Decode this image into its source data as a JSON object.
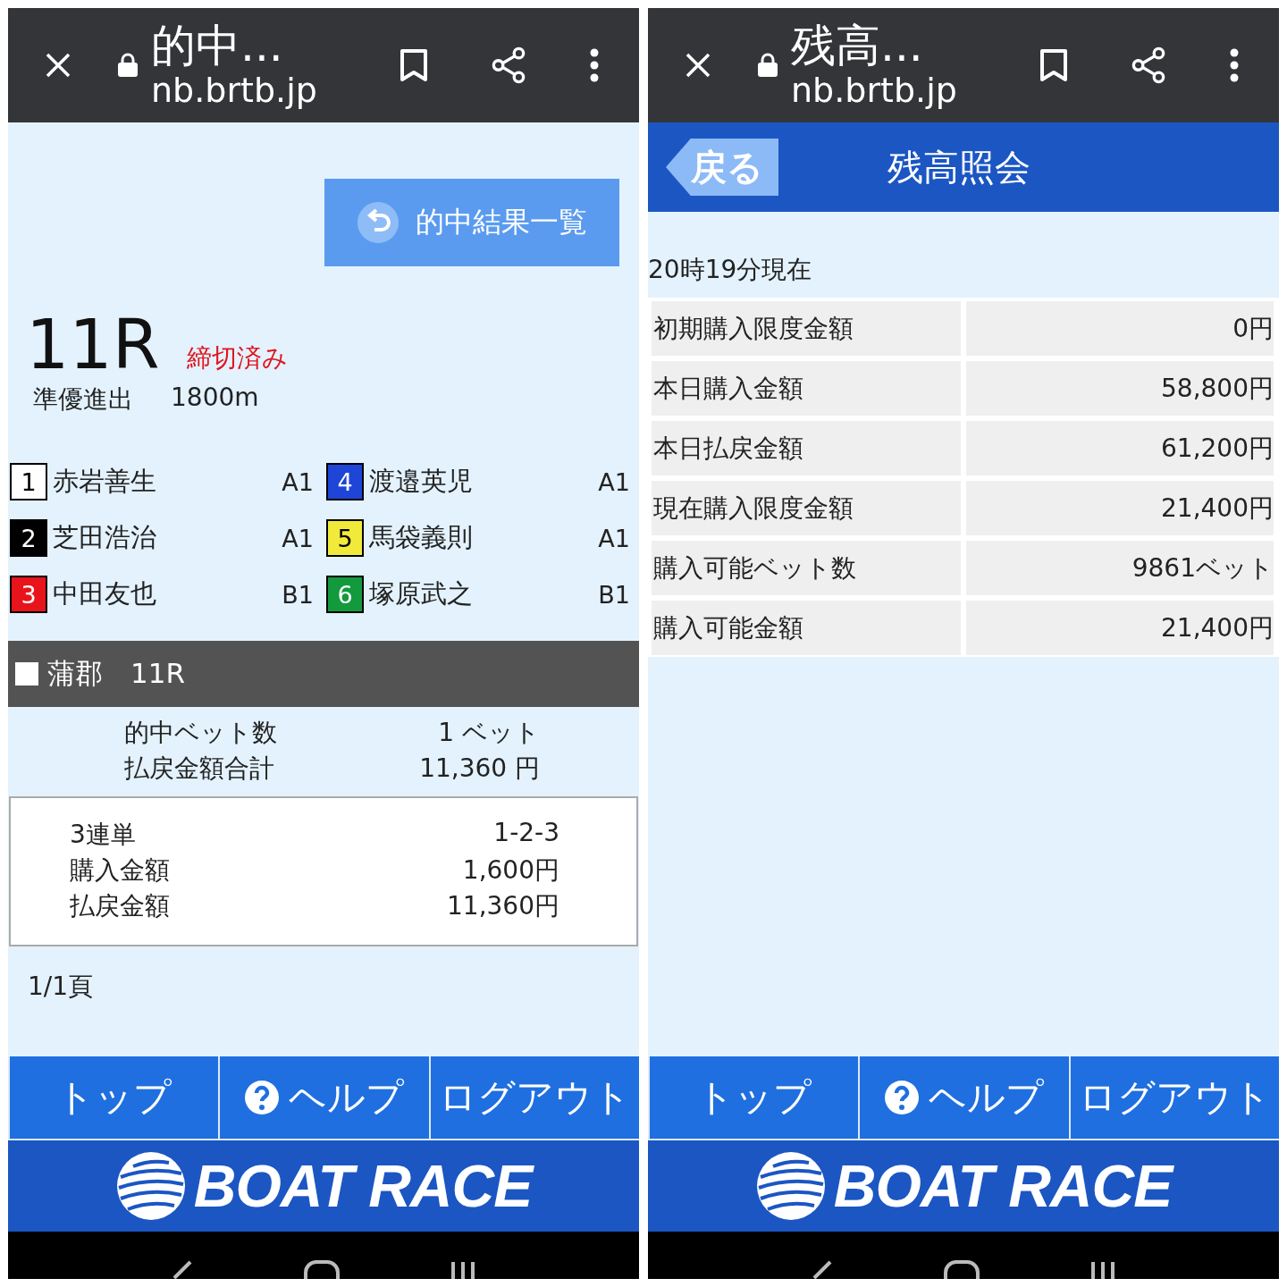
{
  "screens": [
    {
      "kind": "hit_results",
      "browser_bar": {
        "title": "的中...",
        "url": "nb.brtb.jp"
      },
      "results_button": {
        "label": "的中結果一覧"
      },
      "race": {
        "number": "11R",
        "status": "締切済み",
        "name": "準優進出",
        "distance": "1800m"
      },
      "racers": [
        {
          "number": "1",
          "name": "赤岩善生",
          "class": "A1",
          "color": "#ffffff"
        },
        {
          "number": "4",
          "name": "渡邉英児",
          "class": "A1",
          "color": "#1f44d8"
        },
        {
          "number": "2",
          "name": "芝田浩治",
          "class": "A1",
          "color": "#000000"
        },
        {
          "number": "5",
          "name": "馬袋義則",
          "class": "A1",
          "color": "#f2ea3a"
        },
        {
          "number": "3",
          "name": "中田友也",
          "class": "B1",
          "color": "#e8141c"
        },
        {
          "number": "6",
          "name": "塚原武之",
          "class": "B1",
          "color": "#129a3c"
        }
      ],
      "section_header": {
        "venue": "蒲郡",
        "race": "11R"
      },
      "summary": [
        {
          "label": "的中ベット数",
          "value": "1 ベット"
        },
        {
          "label": "払戻金額合計",
          "value": "11,360 円"
        }
      ],
      "bet_card": [
        {
          "label": "3連単",
          "value": "1-2-3"
        },
        {
          "label": "購入金額",
          "value": "1,600円"
        },
        {
          "label": "払戻金額",
          "value": "11,360円"
        }
      ],
      "page_indicator": "1/1頁",
      "bottom_nav": [
        {
          "label": "トップ",
          "kind": "plain"
        },
        {
          "label": "ヘルプ",
          "kind": "help"
        },
        {
          "label": "ログアウト",
          "kind": "plain"
        }
      ],
      "footer_logo": "BOAT RACE"
    },
    {
      "kind": "balance",
      "browser_bar": {
        "title": "残高...",
        "url": "nb.brtb.jp"
      },
      "header": {
        "back_button": "戻る",
        "title": "残高照会"
      },
      "timestamp": "20時19分現在",
      "balance_table": [
        {
          "label": "初期購入限度金額",
          "value": "0円"
        },
        {
          "label": "本日購入金額",
          "value": "58,800円"
        },
        {
          "label": "本日払戻金額",
          "value": "61,200円"
        },
        {
          "label": "現在購入限度金額",
          "value": "21,400円"
        },
        {
          "label": "購入可能ベット数",
          "value": "9861ベット"
        },
        {
          "label": "購入可能金額",
          "value": "21,400円"
        }
      ],
      "bottom_nav": [
        {
          "label": "トップ",
          "kind": "plain"
        },
        {
          "label": "ヘルプ",
          "kind": "help"
        },
        {
          "label": "ログアウト",
          "kind": "plain"
        }
      ],
      "footer_logo": "BOAT RACE"
    }
  ]
}
